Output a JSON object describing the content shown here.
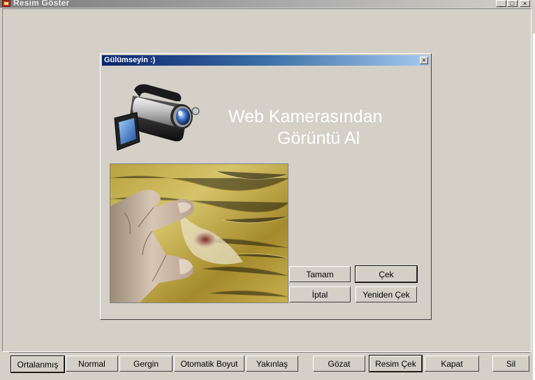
{
  "window": {
    "title": "Resim Göster",
    "minimize": "_",
    "maximize": "□",
    "close": "×"
  },
  "dialog": {
    "title": "Gülümseyin :)",
    "close": "×",
    "headline_line1": "Web  Kamerasından",
    "headline_line2": "Görüntü Al",
    "buttons": {
      "ok": "Tamam",
      "capture": "Çek",
      "cancel": "İptal",
      "recapture": "Yeniden Çek"
    }
  },
  "toolbar": {
    "centered": "Ortalanmış",
    "normal": "Normal",
    "stretch": "Gergin",
    "auto_size": "Otomatik Boyut",
    "zoom": "Yakınlaş",
    "browse": "Gözat",
    "take_picture": "Resim Çek",
    "close": "Kapat",
    "delete": "Sil"
  },
  "colors": {
    "face": "#d4d0c8",
    "dialog_title_start": "#0a246a",
    "dialog_title_end": "#a6caf0"
  }
}
